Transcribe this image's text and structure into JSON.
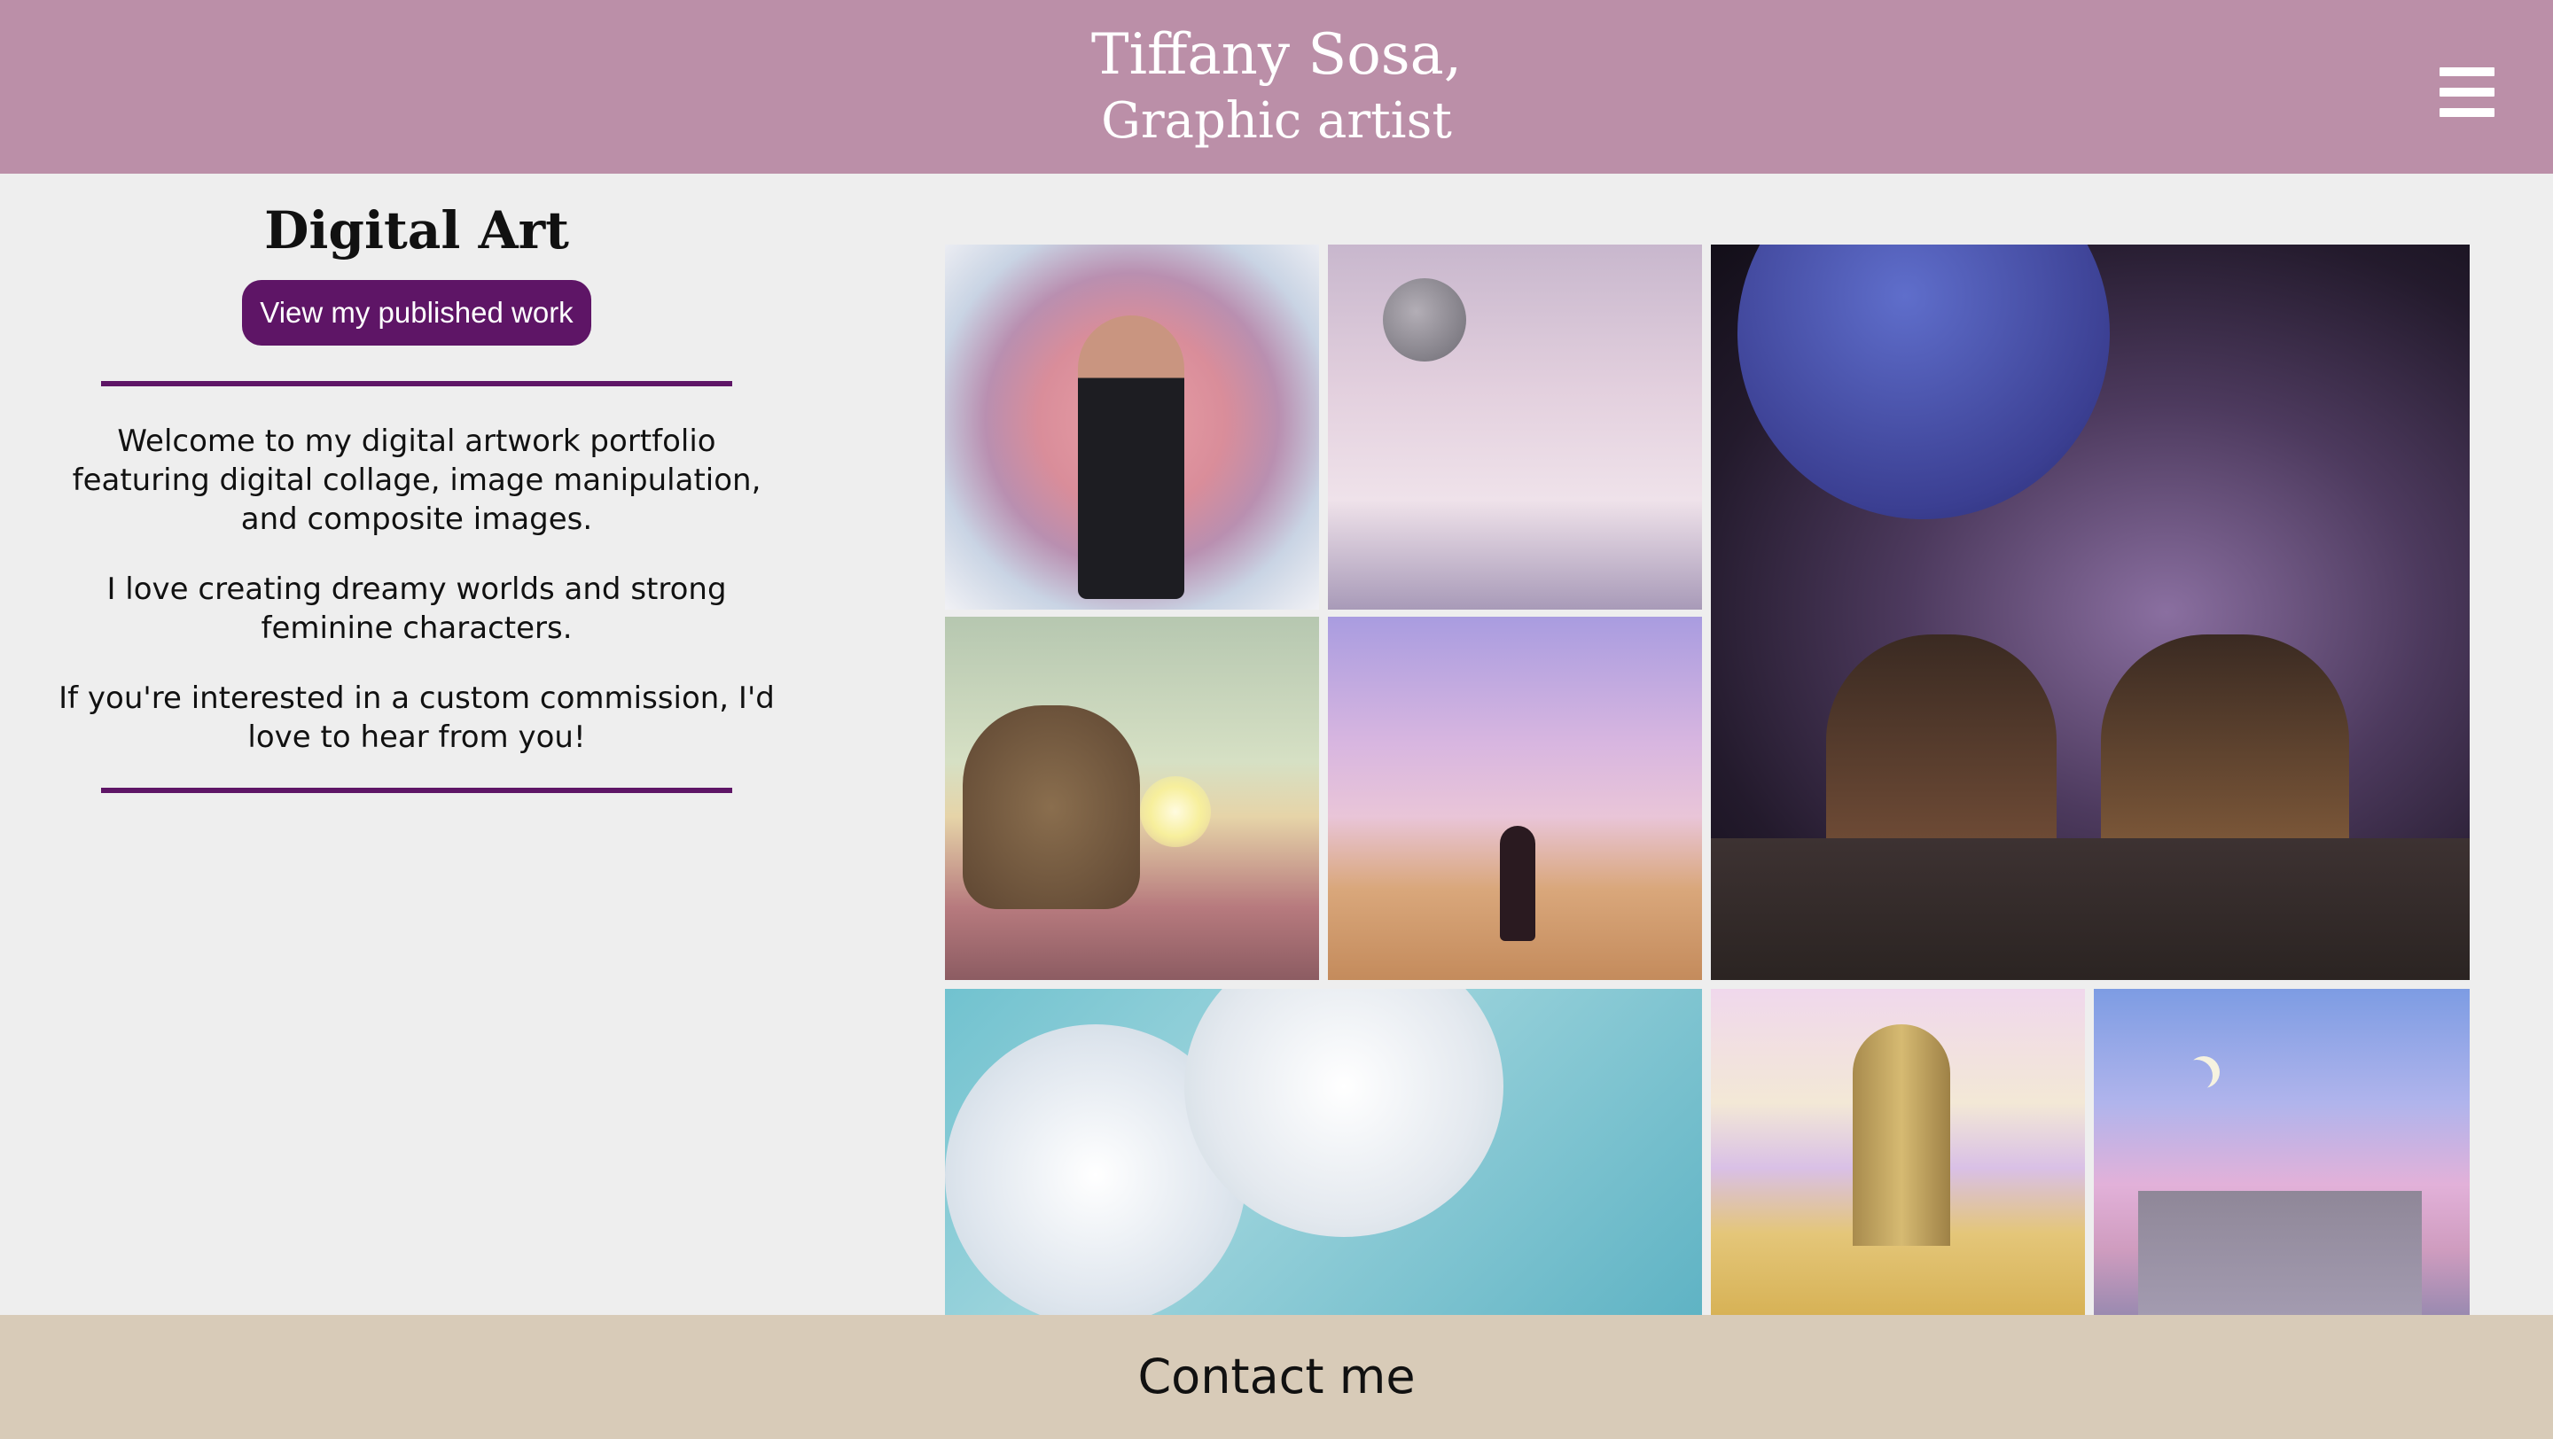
{
  "header": {
    "name": "Tiffany Sosa,",
    "role": "Graphic artist",
    "menu_icon": "hamburger-menu-icon",
    "background_color": "#bb8fa8"
  },
  "sidebar": {
    "title": "Digital Art",
    "published_button_label": "View my published work",
    "paragraphs": [
      "Welcome to my digital artwork portfolio featuring digital collage, image manipulation, and composite images.",
      "I love creating dreamy worlds and strong feminine characters.",
      "If you're interested in a custom commission, I'd love to hear from you!"
    ],
    "accent_color": "#5e1566"
  },
  "gallery": {
    "images": [
      "woman-in-pink-moon-artwork",
      "moon-over-pink-clouds-artwork",
      "girls-pointing-at-galaxy-artwork",
      "highland-cow-and-girl-artwork",
      "girl-on-desert-colonnade-artwork",
      "white-roses-on-turquoise-artwork",
      "golden-door-in-desert-artwork",
      "pink-sky-city-crescent-moon-artwork"
    ]
  },
  "footer": {
    "contact_label": "Contact me",
    "background_color": "#d8cbb8"
  }
}
